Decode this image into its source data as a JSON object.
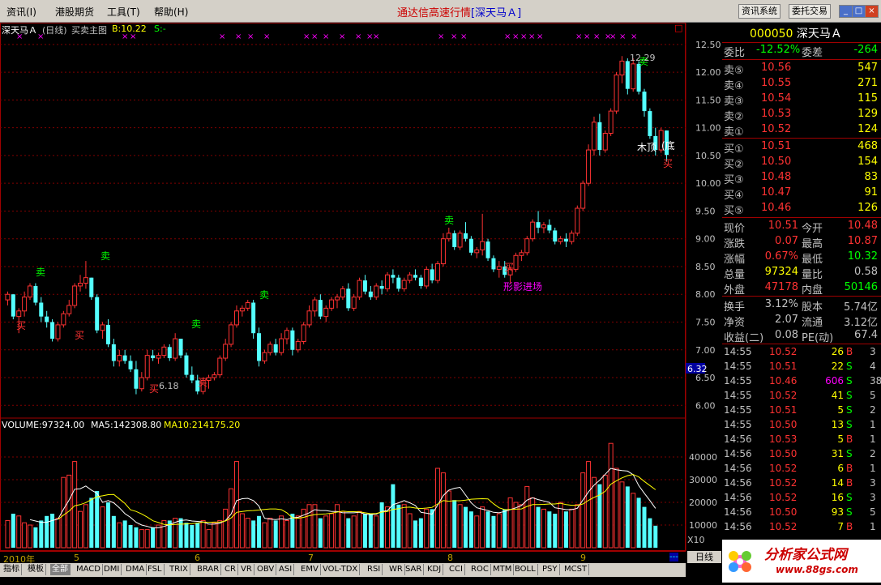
{
  "menu": {
    "items": [
      "资讯(I)",
      "港股期货",
      "工具(T)",
      "帮助(H)"
    ],
    "title": "通达信高速行情",
    "title_stock": "[深天马Ａ]",
    "btn1": "资讯系统",
    "btn2": "委托交易",
    "min": "_",
    "max": "□",
    "close": "×"
  },
  "chart": {
    "header_name": "深天马Ａ",
    "header_period": "(日线)",
    "header_indicator": "买卖主图",
    "header_b": "B:10.22",
    "header_s": "S:-",
    "volume_label": "VOLUME:97324.00",
    "ma5_label": "MA5:142308.80",
    "ma10_label": "MA10:214175.20",
    "y_ticks": [
      "12.50",
      "12.00",
      "11.50",
      "11.00",
      "10.50",
      "10.00",
      "9.50",
      "9.00",
      "8.50",
      "8.00",
      "7.50",
      "7.00",
      "6.50",
      "6.00"
    ],
    "vol_ticks": [
      "40000",
      "30000",
      "20000",
      "10000"
    ],
    "vol_unit": "X10",
    "current_price_tag": "6.32",
    "high_label": "12.29",
    "low_label": "6.18",
    "pattern_label": "形影进场",
    "text_top": "木顶",
    "text_bottom": "(底",
    "buy": "买",
    "sell": "卖",
    "box": "□"
  },
  "chart_data": {
    "type": "candlestick",
    "period": "daily",
    "ylim": [
      5.8,
      12.6
    ],
    "y_ticks": [
      12.5,
      12.0,
      11.5,
      11.0,
      10.5,
      10.0,
      9.5,
      9.0,
      8.5,
      8.0,
      7.5,
      7.0,
      6.5,
      6.0
    ],
    "candles": [
      [
        7.9,
        8.05,
        7.8,
        8.0
      ],
      [
        8.0,
        8.0,
        7.55,
        7.6
      ],
      [
        7.6,
        7.75,
        7.3,
        7.7
      ],
      [
        7.7,
        8.05,
        7.6,
        7.95
      ],
      [
        7.95,
        8.2,
        7.9,
        8.15
      ],
      [
        8.15,
        8.2,
        7.8,
        7.85
      ],
      [
        7.85,
        7.95,
        7.5,
        7.6
      ],
      [
        7.6,
        7.7,
        7.4,
        7.5
      ],
      [
        7.5,
        7.55,
        7.15,
        7.2
      ],
      [
        7.2,
        7.5,
        7.15,
        7.45
      ],
      [
        7.45,
        7.7,
        7.4,
        7.65
      ],
      [
        7.65,
        7.9,
        7.6,
        7.8
      ],
      [
        7.8,
        8.2,
        7.75,
        8.15
      ],
      [
        8.15,
        8.35,
        8.05,
        8.2
      ],
      [
        8.2,
        8.6,
        8.1,
        8.3
      ],
      [
        8.3,
        8.3,
        7.9,
        7.95
      ],
      [
        7.95,
        8.0,
        7.3,
        7.35
      ],
      [
        7.35,
        7.5,
        7.2,
        7.45
      ],
      [
        7.45,
        7.55,
        7.05,
        7.1
      ],
      [
        7.1,
        7.2,
        6.7,
        6.8
      ],
      [
        6.8,
        7.0,
        6.7,
        6.9
      ],
      [
        6.9,
        7.0,
        6.75,
        6.8
      ],
      [
        6.8,
        6.9,
        6.6,
        6.65
      ],
      [
        6.65,
        6.8,
        6.2,
        6.3
      ],
      [
        6.3,
        6.6,
        6.25,
        6.5
      ],
      [
        6.5,
        7.0,
        6.45,
        6.9
      ],
      [
        6.9,
        7.0,
        6.8,
        6.85
      ],
      [
        6.85,
        6.95,
        6.75,
        6.9
      ],
      [
        6.9,
        7.1,
        6.85,
        7.05
      ],
      [
        7.05,
        7.1,
        6.8,
        6.85
      ],
      [
        6.85,
        7.3,
        6.8,
        7.2
      ],
      [
        7.2,
        7.2,
        6.85,
        6.9
      ],
      [
        6.9,
        6.95,
        6.5,
        6.55
      ],
      [
        6.55,
        6.7,
        6.4,
        6.45
      ],
      [
        6.45,
        6.55,
        6.2,
        6.25
      ],
      [
        6.25,
        6.5,
        6.2,
        6.45
      ],
      [
        6.45,
        6.55,
        6.3,
        6.5
      ],
      [
        6.5,
        6.6,
        6.45,
        6.55
      ],
      [
        6.55,
        6.9,
        6.5,
        6.85
      ],
      [
        6.85,
        7.2,
        6.8,
        7.1
      ],
      [
        7.1,
        7.5,
        7.05,
        7.45
      ],
      [
        7.45,
        7.8,
        7.4,
        7.7
      ],
      [
        7.7,
        7.8,
        7.6,
        7.75
      ],
      [
        7.75,
        7.9,
        7.7,
        7.85
      ],
      [
        7.85,
        7.9,
        7.2,
        7.3
      ],
      [
        7.3,
        7.4,
        6.7,
        6.8
      ],
      [
        6.8,
        7.0,
        6.75,
        6.95
      ],
      [
        6.95,
        7.15,
        6.9,
        7.1
      ],
      [
        7.1,
        7.2,
        6.9,
        6.95
      ],
      [
        6.95,
        7.3,
        6.9,
        7.2
      ],
      [
        7.2,
        7.4,
        7.1,
        7.35
      ],
      [
        7.35,
        7.4,
        6.9,
        7.0
      ],
      [
        7.0,
        7.2,
        6.95,
        7.15
      ],
      [
        7.15,
        7.5,
        7.1,
        7.45
      ],
      [
        7.45,
        7.8,
        7.4,
        7.7
      ],
      [
        7.7,
        7.95,
        7.6,
        7.9
      ],
      [
        7.9,
        8.0,
        7.55,
        7.6
      ],
      [
        7.6,
        7.8,
        7.5,
        7.75
      ],
      [
        7.75,
        7.95,
        7.7,
        7.9
      ],
      [
        7.9,
        8.0,
        7.75,
        7.95
      ],
      [
        7.95,
        8.15,
        7.9,
        8.1
      ],
      [
        8.1,
        8.2,
        7.7,
        7.75
      ],
      [
        7.75,
        8.0,
        7.7,
        7.95
      ],
      [
        7.95,
        8.3,
        7.9,
        8.25
      ],
      [
        8.25,
        8.35,
        8.0,
        8.05
      ],
      [
        8.05,
        8.15,
        7.9,
        7.95
      ],
      [
        7.95,
        8.2,
        7.9,
        8.15
      ],
      [
        8.15,
        8.25,
        8.0,
        8.1
      ],
      [
        8.1,
        8.4,
        8.05,
        8.35
      ],
      [
        8.35,
        8.45,
        8.2,
        8.3
      ],
      [
        8.3,
        8.35,
        8.05,
        8.1
      ],
      [
        8.1,
        8.3,
        8.05,
        8.25
      ],
      [
        8.25,
        8.4,
        8.2,
        8.35
      ],
      [
        8.35,
        8.45,
        8.25,
        8.3
      ],
      [
        8.3,
        8.35,
        8.1,
        8.15
      ],
      [
        8.15,
        8.5,
        8.1,
        8.45
      ],
      [
        8.45,
        8.55,
        8.2,
        8.25
      ],
      [
        8.25,
        8.6,
        8.2,
        8.55
      ],
      [
        8.55,
        9.1,
        8.5,
        9.0
      ],
      [
        9.0,
        9.2,
        8.95,
        9.1
      ],
      [
        9.1,
        9.15,
        8.8,
        8.85
      ],
      [
        8.85,
        9.15,
        8.8,
        9.1
      ],
      [
        9.1,
        9.3,
        8.95,
        9.0
      ],
      [
        9.0,
        9.05,
        8.7,
        8.75
      ],
      [
        8.75,
        8.85,
        8.65,
        8.8
      ],
      [
        8.8,
        9.45,
        8.7,
        8.95
      ],
      [
        8.95,
        9.0,
        8.6,
        8.65
      ],
      [
        8.65,
        8.7,
        8.4,
        8.45
      ],
      [
        8.45,
        8.6,
        8.3,
        8.5
      ],
      [
        8.5,
        8.6,
        8.3,
        8.35
      ],
      [
        8.35,
        8.5,
        8.2,
        8.45
      ],
      [
        8.45,
        8.75,
        8.4,
        8.7
      ],
      [
        8.7,
        8.8,
        8.6,
        8.75
      ],
      [
        8.75,
        9.05,
        8.7,
        9.0
      ],
      [
        9.0,
        9.35,
        8.95,
        9.3
      ],
      [
        9.3,
        9.5,
        9.1,
        9.2
      ],
      [
        9.2,
        9.3,
        9.1,
        9.25
      ],
      [
        9.25,
        9.35,
        9.1,
        9.15
      ],
      [
        9.15,
        9.2,
        8.9,
        8.95
      ],
      [
        8.95,
        9.05,
        8.9,
        9.0
      ],
      [
        9.0,
        9.1,
        8.85,
        8.95
      ],
      [
        8.95,
        9.15,
        8.9,
        9.1
      ],
      [
        9.1,
        9.6,
        9.05,
        9.55
      ],
      [
        9.55,
        10.05,
        9.5,
        10.0
      ],
      [
        10.0,
        10.7,
        9.95,
        10.6
      ],
      [
        10.6,
        11.2,
        10.5,
        11.1
      ],
      [
        11.1,
        11.25,
        10.5,
        10.6
      ],
      [
        10.6,
        10.95,
        10.55,
        10.9
      ],
      [
        10.9,
        11.35,
        10.85,
        11.3
      ],
      [
        11.3,
        12.0,
        11.25,
        11.95
      ],
      [
        11.95,
        12.29,
        11.8,
        12.2
      ],
      [
        12.2,
        12.25,
        11.6,
        11.7
      ],
      [
        11.7,
        12.25,
        11.65,
        12.15
      ],
      [
        12.15,
        12.2,
        11.6,
        11.65
      ],
      [
        11.65,
        11.7,
        11.2,
        11.3
      ],
      [
        11.3,
        11.35,
        10.8,
        10.85
      ],
      [
        10.85,
        11.0,
        10.5,
        10.6
      ],
      [
        10.6,
        11.0,
        10.55,
        10.95
      ],
      [
        10.95,
        10.95,
        10.4,
        10.51
      ]
    ],
    "volume": [
      12000,
      15000,
      14000,
      11000,
      10000,
      9000,
      12000,
      14000,
      15000,
      13000,
      31000,
      32000,
      38000,
      16000,
      19000,
      22000,
      25000,
      18000,
      20000,
      14000,
      11000,
      12000,
      10000,
      9000,
      8000,
      8000,
      9000,
      10000,
      12000,
      12000,
      13000,
      13000,
      11000,
      10000,
      11000,
      12000,
      8000,
      11000,
      12000,
      17000,
      26000,
      38000,
      15000,
      13000,
      12000,
      14000,
      11000,
      13000,
      12000,
      14000,
      12000,
      15000,
      14000,
      17000,
      19000,
      19000,
      13000,
      14000,
      15000,
      19000,
      16000,
      13000,
      14000,
      16000,
      15000,
      15000,
      14000,
      20000,
      18000,
      28000,
      19000,
      19000,
      15000,
      12000,
      13000,
      17000,
      17000,
      35000,
      33000,
      25000,
      21000,
      19000,
      18000,
      16000,
      14000,
      18000,
      16000,
      14000,
      15000,
      17000,
      22000,
      20000,
      19000,
      27000,
      22000,
      18000,
      17000,
      16000,
      15000,
      20000,
      16000,
      17000,
      19000,
      33000,
      38000,
      31000,
      28000,
      32000,
      46000,
      35000,
      29000,
      27000,
      24000,
      22000,
      18000,
      13000,
      9700
    ],
    "ma5_label": "MA5:142308.80",
    "ma10_label": "MA10:214175.20",
    "vol_ylim": [
      0,
      50000
    ],
    "x_labels": [
      "2010年",
      "5",
      "6",
      "7",
      "8",
      "9"
    ]
  },
  "quote": {
    "code": "000050",
    "name": "深天马Ａ",
    "wb_label": "委比",
    "wb_val": "-12.52%",
    "wc_label": "委差",
    "wc_val": "-264",
    "asks": [
      {
        "l": "卖⑤",
        "p": "10.56",
        "v": "547"
      },
      {
        "l": "卖④",
        "p": "10.55",
        "v": "271"
      },
      {
        "l": "卖③",
        "p": "10.54",
        "v": "115"
      },
      {
        "l": "卖②",
        "p": "10.53",
        "v": "129"
      },
      {
        "l": "卖①",
        "p": "10.52",
        "v": "124"
      }
    ],
    "bids": [
      {
        "l": "买①",
        "p": "10.51",
        "v": "468"
      },
      {
        "l": "买②",
        "p": "10.50",
        "v": "154"
      },
      {
        "l": "买③",
        "p": "10.48",
        "v": "83"
      },
      {
        "l": "买④",
        "p": "10.47",
        "v": "91"
      },
      {
        "l": "买⑤",
        "p": "10.46",
        "v": "126"
      }
    ],
    "stats": [
      {
        "l1": "现价",
        "v1": "10.51",
        "l2": "今开",
        "v2": "10.48"
      },
      {
        "l1": "涨跌",
        "v1": "0.07",
        "l2": "最高",
        "v2": "10.87"
      },
      {
        "l1": "涨幅",
        "v1": "0.67%",
        "l2": "最低",
        "v2": "10.32"
      },
      {
        "l1": "总量",
        "v1": "97324",
        "l2": "量比",
        "v2": "0.58"
      },
      {
        "l1": "外盘",
        "v1": "47178",
        "l2": "内盘",
        "v2": "50146"
      }
    ],
    "stats2": [
      {
        "l1": "换手",
        "v1": "3.12%",
        "l2": "股本",
        "v2": "5.74亿"
      },
      {
        "l1": "净资",
        "v1": "2.07",
        "l2": "流通",
        "v2": "3.12亿"
      },
      {
        "l1": "收益(二)",
        "v1": "0.08",
        "l2": "PE(动)",
        "v2": "67.4"
      }
    ],
    "ticks": [
      {
        "t": "14:55",
        "p": "10.52",
        "v": "26",
        "s": "B",
        "n": "3"
      },
      {
        "t": "14:55",
        "p": "10.51",
        "v": "22",
        "s": "S",
        "n": "4"
      },
      {
        "t": "14:55",
        "p": "10.46",
        "v": "606",
        "s": "S",
        "n": "38"
      },
      {
        "t": "14:55",
        "p": "10.52",
        "v": "41",
        "s": "S",
        "n": "5"
      },
      {
        "t": "14:55",
        "p": "10.51",
        "v": "5",
        "s": "S",
        "n": "2"
      },
      {
        "t": "14:55",
        "p": "10.50",
        "v": "13",
        "s": "S",
        "n": "1"
      },
      {
        "t": "14:56",
        "p": "10.53",
        "v": "5",
        "s": "B",
        "n": "1"
      },
      {
        "t": "14:56",
        "p": "10.50",
        "v": "31",
        "s": "S",
        "n": "2"
      },
      {
        "t": "14:56",
        "p": "10.52",
        "v": "6",
        "s": "B",
        "n": "1"
      },
      {
        "t": "14:56",
        "p": "10.52",
        "v": "14",
        "s": "B",
        "n": "3"
      },
      {
        "t": "14:56",
        "p": "10.52",
        "v": "16",
        "s": "S",
        "n": "3"
      },
      {
        "t": "14:56",
        "p": "10.50",
        "v": "93",
        "s": "S",
        "n": "5"
      },
      {
        "t": "14:56",
        "p": "10.52",
        "v": "7",
        "s": "B",
        "n": "1"
      }
    ]
  },
  "bottom": {
    "period_btn": "日线",
    "more": "---",
    "tabs": [
      "指标",
      "模板",
      "全部",
      "MACD",
      "DMI",
      "DMA",
      "FSL",
      "TRIX",
      "BRAR",
      "CR",
      "VR",
      "OBV",
      "ASI",
      "EMV",
      "VOL-TDX",
      "RSI",
      "WR",
      "SAR",
      "KDJ",
      "CCI",
      "ROC",
      "MTM",
      "BOLL",
      "PSY",
      "MCST"
    ]
  },
  "logo": {
    "text": "分析家公式网",
    "url": "www.88gs.com"
  },
  "colors": {
    "up": "#ff3232",
    "down": "#54ffff",
    "ma5": "#ffffff",
    "ma10": "#ffff00",
    "grid": "#800000"
  }
}
